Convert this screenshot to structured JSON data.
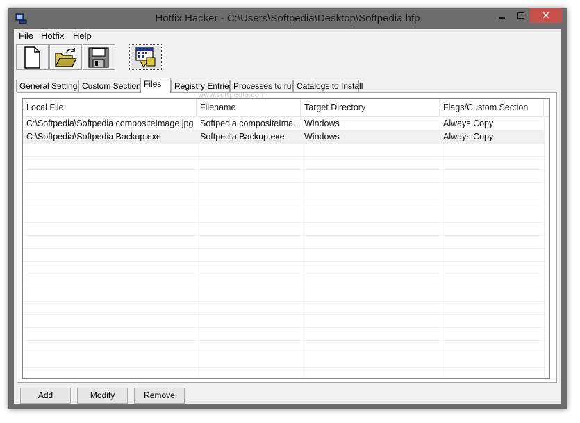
{
  "window": {
    "title": "Hotfix Hacker - C:\\Users\\Softpedia\\Desktop\\Softpedia.hfp",
    "close_glyph": "✕"
  },
  "menu": {
    "items": [
      "File",
      "Hotfix",
      "Help"
    ]
  },
  "toolbar": {
    "icons": [
      "new-document-icon",
      "open-folder-icon",
      "save-floppy-icon",
      "build-hotfix-icon"
    ]
  },
  "tabs": {
    "items": [
      "General Settings",
      "Custom Sections",
      "Files",
      "Registry Entries",
      "Processes to run",
      "Catalogs to Install"
    ],
    "selected": "Files"
  },
  "files_list": {
    "columns": [
      "Local File",
      "Filename",
      "Target Directory",
      "Flags/Custom Section"
    ],
    "rows": [
      [
        "C:\\Softpedia\\Softpedia compositeImage.jpg",
        "Softpedia compositeIma...",
        "Windows",
        "Always Copy"
      ],
      [
        "C:\\Softpedia\\Softpedia Backup.exe",
        "Softpedia Backup.exe",
        "Windows",
        "Always Copy"
      ]
    ],
    "selected_row": 1
  },
  "buttons": {
    "add": "Add",
    "modify": "Modify",
    "remove": "Remove"
  },
  "watermark": "www.softpedia.com",
  "colors": {
    "titlebar": "#6d6d6d",
    "close_button": "#c7504a",
    "window_face": "#f0f0f0"
  }
}
